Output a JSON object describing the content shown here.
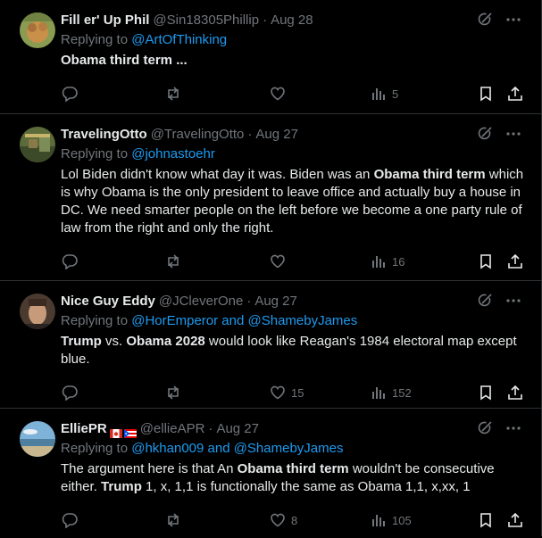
{
  "tweets": [
    {
      "name": "Fill er' Up Phil",
      "handle": "@Sin18305Phillip",
      "sep": "·",
      "date": "Aug 28",
      "replying_prefix": "Replying to",
      "replying_to": "@ArtOfThinking",
      "body_segments": [
        {
          "text": "Obama third term ...",
          "bold": true
        }
      ],
      "stats": {
        "replies": "",
        "reposts": "",
        "likes": "",
        "views": "5"
      }
    },
    {
      "name": "TravelingOtto",
      "handle": "@TravelingOtto",
      "sep": "·",
      "date": "Aug 27",
      "replying_prefix": "Replying to",
      "replying_to": "@johnastoehr",
      "body_segments": [
        {
          "text": "Lol Biden didn't know what day it was. Biden was an ",
          "bold": false
        },
        {
          "text": "Obama third term",
          "bold": true
        },
        {
          "text": " which is why Obama is the only president to leave office and actually buy a house in DC. We need smarter people on the left before we become a one party rule of law from the right and only the right.",
          "bold": false
        }
      ],
      "stats": {
        "replies": "",
        "reposts": "",
        "likes": "",
        "views": "16"
      }
    },
    {
      "name": "Nice Guy Eddy",
      "handle": "@JCleverOne",
      "sep": "·",
      "date": "Aug 27",
      "replying_prefix": "Replying to",
      "replying_to": "@HorEmperor and @ShamebyJames",
      "body_segments": [
        {
          "text": "Trump",
          "bold": true
        },
        {
          "text": " vs. ",
          "bold": false
        },
        {
          "text": "Obama 2028",
          "bold": true
        },
        {
          "text": " would look like Reagan's 1984 electoral map except blue.",
          "bold": false
        }
      ],
      "stats": {
        "replies": "",
        "reposts": "",
        "likes": "15",
        "views": "152"
      }
    },
    {
      "name": "ElliePR",
      "handle": "@ellieAPR",
      "sep": "·",
      "date": "Aug 27",
      "replying_prefix": "Replying to",
      "replying_to": "@hkhan009 and @ShamebyJames",
      "body_segments": [
        {
          "text": "The argument here is that An ",
          "bold": false
        },
        {
          "text": "Obama third term",
          "bold": true
        },
        {
          "text": " wouldn't be consecutive either. ",
          "bold": false
        },
        {
          "text": "Trump",
          "bold": true
        },
        {
          "text": " 1, x, 1,1 is functionally the same as Obama 1,1, x,xx, 1",
          "bold": false
        }
      ],
      "stats": {
        "replies": "",
        "reposts": "",
        "likes": "8",
        "views": "105"
      }
    }
  ],
  "colors": {
    "background": "#000000",
    "text": "#e7e9ea",
    "muted": "#71767b",
    "link": "#1d9bf0",
    "divider": "#2f3336"
  },
  "icons": [
    "grok-icon",
    "more-icon",
    "reply-icon",
    "repost-icon",
    "like-icon",
    "views-icon",
    "bookmark-icon",
    "share-icon"
  ]
}
